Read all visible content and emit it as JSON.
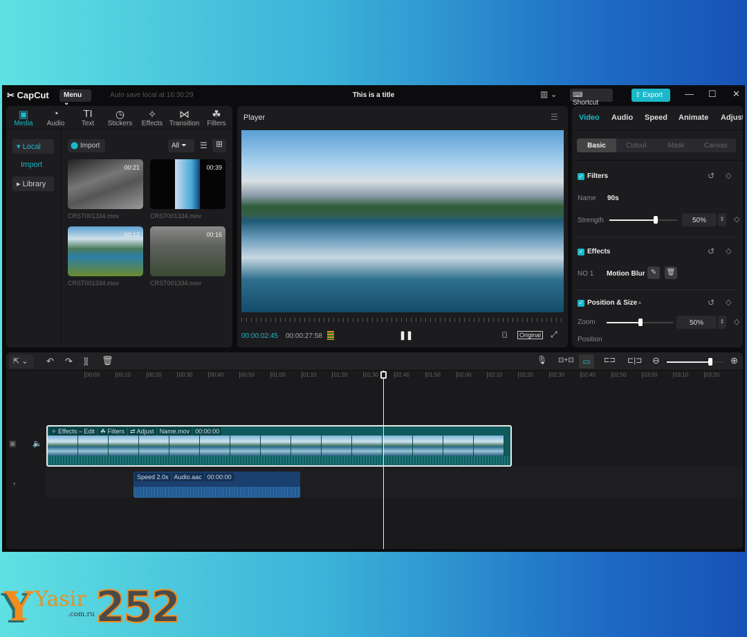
{
  "app": {
    "name": "CapCut",
    "menu_label": "Menu",
    "autosave": "Auto save local at 16:30:29",
    "title": "This is a title",
    "shortcut_label": "Shortcut",
    "export_label": "Export"
  },
  "media_tabs": [
    {
      "label": "Media",
      "icon": "media-icon"
    },
    {
      "label": "Audio",
      "icon": "audio-icon"
    },
    {
      "label": "Text",
      "icon": "text-icon"
    },
    {
      "label": "Stickers",
      "icon": "sticker-icon"
    },
    {
      "label": "Effects",
      "icon": "effects-icon"
    },
    {
      "label": "Transition",
      "icon": "transition-icon"
    },
    {
      "label": "Filters",
      "icon": "filters-icon"
    }
  ],
  "media_tab_glyphs": [
    "▣",
    "◔",
    "TI",
    "◷",
    "✧",
    "⋈",
    "☘"
  ],
  "sidebar": {
    "local": "Local",
    "import": "Import",
    "library": "Library"
  },
  "media": {
    "import_label": "Import",
    "filter_label": "All",
    "items": [
      {
        "name": "CRST001334.mov",
        "duration": "00:21"
      },
      {
        "name": "CRST001334.mov",
        "duration": "00:39"
      },
      {
        "name": "CRST001334.mov",
        "duration": "00:12"
      },
      {
        "name": "CRST001334.mov",
        "duration": "00:16"
      }
    ]
  },
  "player": {
    "title": "Player",
    "current_time": "00:00:02:45",
    "total_time": "00:00:27:58",
    "ratio_label": "Original"
  },
  "inspector": {
    "tabs": [
      "Video",
      "Audio",
      "Speed",
      "Animate",
      "Adjust"
    ],
    "subtabs": [
      "Basic",
      "Cutout",
      "Mask",
      "Canvas"
    ],
    "filters": {
      "title": "Filters",
      "name_label": "Name",
      "name_value": "90s",
      "strength_label": "Strength",
      "strength_value": "50%",
      "strength": 0.5
    },
    "effects": {
      "title": "Effects",
      "index": "NO 1",
      "name": "Motion Blur"
    },
    "position": {
      "title": "Position & Size",
      "zoom_label": "Zoom",
      "zoom_value": "50%",
      "zoom": 0.5,
      "position_label": "Position"
    }
  },
  "timeline": {
    "ruler": [
      "00:00",
      "00:10",
      "00:20",
      "00:30",
      "00:40",
      "00:50",
      "01:00",
      "01:10",
      "01:20",
      "01:30",
      "01:40",
      "01:50",
      "02:00",
      "02:10",
      "02:20",
      "02:30",
      "02:40",
      "02:50",
      "03:00",
      "03:10",
      "03:20"
    ],
    "video_clip": {
      "effects": "Effects – Edit",
      "filters": "Filters",
      "adjust": "Adjust",
      "name": "Name.mov",
      "time": "00:00:00"
    },
    "audio_clip": {
      "speed": "Speed 2.0x",
      "name": "Audio.aac",
      "time": "00:00:00"
    },
    "zoom_level": 0.75
  },
  "watermark": {
    "text": "Yasir",
    "domain": ".com.ru",
    "number": "252"
  },
  "colors": {
    "accent": "#1bb8c9",
    "audio_clip": "#1b3f6e",
    "video_clip": "#0f5a5c"
  }
}
